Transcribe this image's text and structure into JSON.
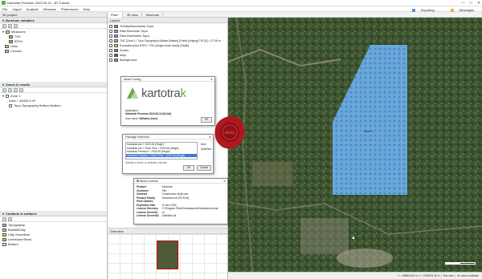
{
  "window": {
    "title": "Kartotrak Premium 2023.06.13 - 3D Tutorial",
    "controls": [
      "—",
      "□",
      "✕"
    ]
  },
  "menu": [
    "File",
    "Import",
    "Analysis",
    "Windows",
    "Preferences",
    "Help"
  ],
  "toolbar_right": {
    "exporting": "Exporting",
    "messages": "Messages"
  },
  "left_panel": {
    "header": "3D project",
    "variables_title": "Borehole variables",
    "variables": [
      {
        "label": "Measures",
        "level": 0
      },
      {
        "label": "THC",
        "level": 1
      },
      {
        "label": "BTEX",
        "level": 1
      },
      {
        "label": "Lithic",
        "level": 0
      },
      {
        "label": "Contact",
        "level": 0
      }
    ],
    "zones_title": "Zones & results",
    "zones": [
      {
        "label": "Zone 1",
        "level": 0
      },
      {
        "label": "Area = 40000.0 m²",
        "level": 1
      },
      {
        "label": "Topo-Topography Bottom-Bottom",
        "level": 1
      }
    ],
    "contacts_title": "Contacts & surfaces",
    "contacts": [
      {
        "label": "Topography",
        "color": "#c9a3e6"
      },
      {
        "label": "Backfill/Clay",
        "color": "#b5d98a"
      },
      {
        "label": "Clay Sometime",
        "color": "#e8d070"
      },
      {
        "label": "Limestone/Sand",
        "color": "#f0a860"
      },
      {
        "label": "Bottom",
        "color": "#e6e6e6"
      }
    ]
  },
  "tabs": [
    "Plan*",
    "3D view",
    "Borehole"
  ],
  "layers_panel": {
    "title": "Layers",
    "items": [
      "Trimble/Boreholes Topo",
      "Raw Borehole Topo",
      "Raw Boreholes Topo",
      "THC (Zone 1 / Topo-Topography Bottom-Bottom) (Point) (Kriging) THC[1] = 27.06 m",
      "Excavation plan BTEX / THC (single mode result) (Depth)",
      "Zones",
      "Map",
      "Background"
    ],
    "overview_title": "Overview"
  },
  "about_dialog": {
    "title": "About Config...",
    "logo_text_a": "kartotra",
    "logo_text_b": "k",
    "application_label": "Application:",
    "application_value": "Kartotrak Premium 2023.06.13 (64-bit)",
    "user_label": "User name:",
    "user_value": "Williams (User)",
    "ok_label": "OK"
  },
  "package_dialog": {
    "title": "Package Selection",
    "items": [
      "Kartotrak.exe + 2023.06 (Single)",
      "Kartotrak.exe + Rock Time + 2023.06 (Single)",
      "Kartotrak Premium + 2023.06 (Single)",
      "Kartotrak Premium + Rock Time + 2023.06 (Single)"
    ],
    "selected_index": 3,
    "side_buttons": [
      "New",
      "Add/Rem"
    ],
    "hint": "Specify a server or activate a license",
    "ok": "OK",
    "cancel": "Cancel"
  },
  "license_dialog": {
    "title": "About License",
    "rows": [
      [
        "Product",
        "Kartotrak"
      ],
      [
        "Customer",
        "Kite"
      ],
      [
        "Contract",
        "Commercial, Multi-user"
      ],
      [
        "Product Family",
        "Kartotrak.exe (2023.06)"
      ],
      [
        "Pack Options",
        ""
      ],
      [
        "Expiration Date",
        "31-dec-2050"
      ],
      [
        "License Directory",
        "C:/Program Files/Geovariances/Kartotrak/License"
      ],
      [
        "License ServerID",
        "ck"
      ],
      [
        "License ServerID2",
        "Unlimited all"
      ]
    ]
  },
  "seal": {
    "text": "SEAL"
  },
  "map": {
    "zone_label": "Zone 1",
    "zone_color": "#6fb3f2",
    "point_color": "#2b5fa8"
  },
  "status": {
    "coords": "X = 698806.83 m; Y = 2785821.98 m",
    "mode": "Pan view",
    "state": "No action available"
  },
  "colors": {
    "title_bg": "#ffffff",
    "accent": "#6aa84f",
    "seal": "#b0171f"
  }
}
